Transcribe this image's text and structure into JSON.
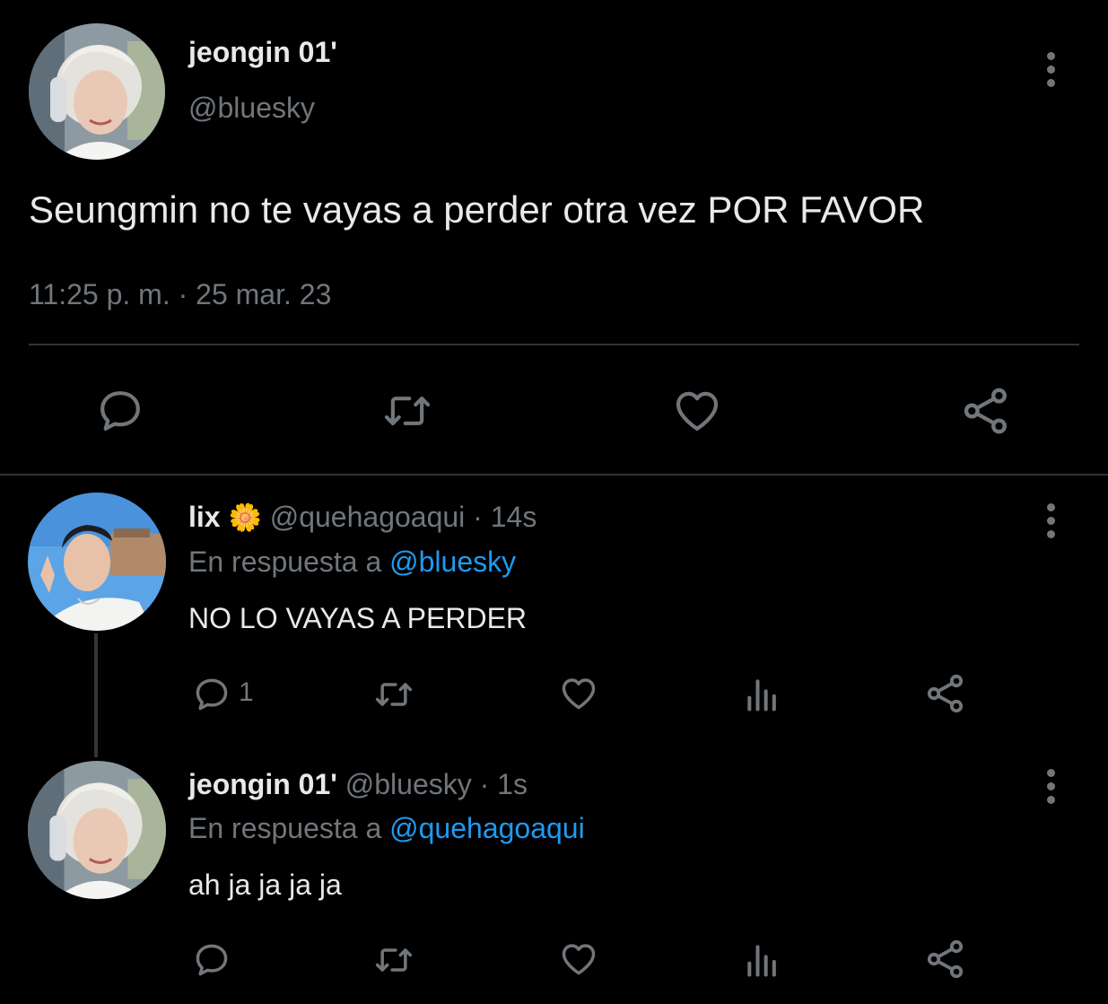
{
  "main_tweet": {
    "display_name": "jeongin 01'",
    "handle": "@bluesky",
    "text": "Seungmin no te vayas a perder otra vez POR FAVOR",
    "timestamp": "11:25 p. m. · 25 mar. 23"
  },
  "replies": [
    {
      "display_name": "lix",
      "emoji": "🌼",
      "handle": "@quehagoaqui",
      "age": "· 14s",
      "reply_prefix": "En respuesta a",
      "reply_to": "@bluesky",
      "text": "NO LO VAYAS A PERDER",
      "reply_count": "1"
    },
    {
      "display_name": "jeongin 01'",
      "handle": "@bluesky",
      "age": "· 1s",
      "reply_prefix": "En respuesta a",
      "reply_to": "@quehagoaqui",
      "text": "ah ja ja ja ja",
      "reply_count": ""
    }
  ],
  "icons": {
    "reply": "reply-icon",
    "retweet": "retweet-icon",
    "like": "heart-icon",
    "views": "views-icon",
    "share": "share-icon",
    "more": "more-options-icon"
  },
  "colors": {
    "background": "#000000",
    "text": "#e7e9ea",
    "secondary": "#71767b",
    "link": "#1d9bf0",
    "divider": "#2f3336"
  }
}
